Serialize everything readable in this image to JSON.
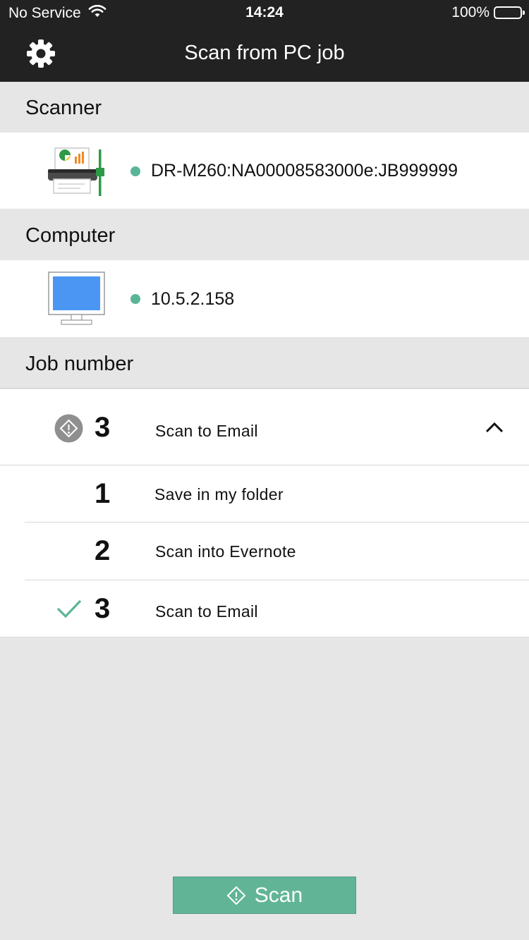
{
  "status_bar": {
    "carrier": "No Service",
    "time": "14:24",
    "battery": "100%"
  },
  "header": {
    "title": "Scan from PC job",
    "settings_icon": "gear-icon"
  },
  "scanner": {
    "section_label": "Scanner",
    "device_name": "DR-M260:NA00008583000e:JB999999",
    "status_color": "#5ab598"
  },
  "computer": {
    "section_label": "Computer",
    "address": "10.5.2.158",
    "status_color": "#5ab598"
  },
  "job": {
    "section_label": "Job number",
    "selected": {
      "number": "3",
      "label": "Scan to Email"
    },
    "options": [
      {
        "number": "1",
        "label": "Save in my folder",
        "checked": false
      },
      {
        "number": "2",
        "label": "Scan into Evernote",
        "checked": false
      },
      {
        "number": "3",
        "label": "Scan to Email",
        "checked": true
      }
    ]
  },
  "actions": {
    "scan_label": "Scan"
  },
  "colors": {
    "accent": "#61b596",
    "header_bg": "#222222",
    "background": "#e6e6e6"
  }
}
